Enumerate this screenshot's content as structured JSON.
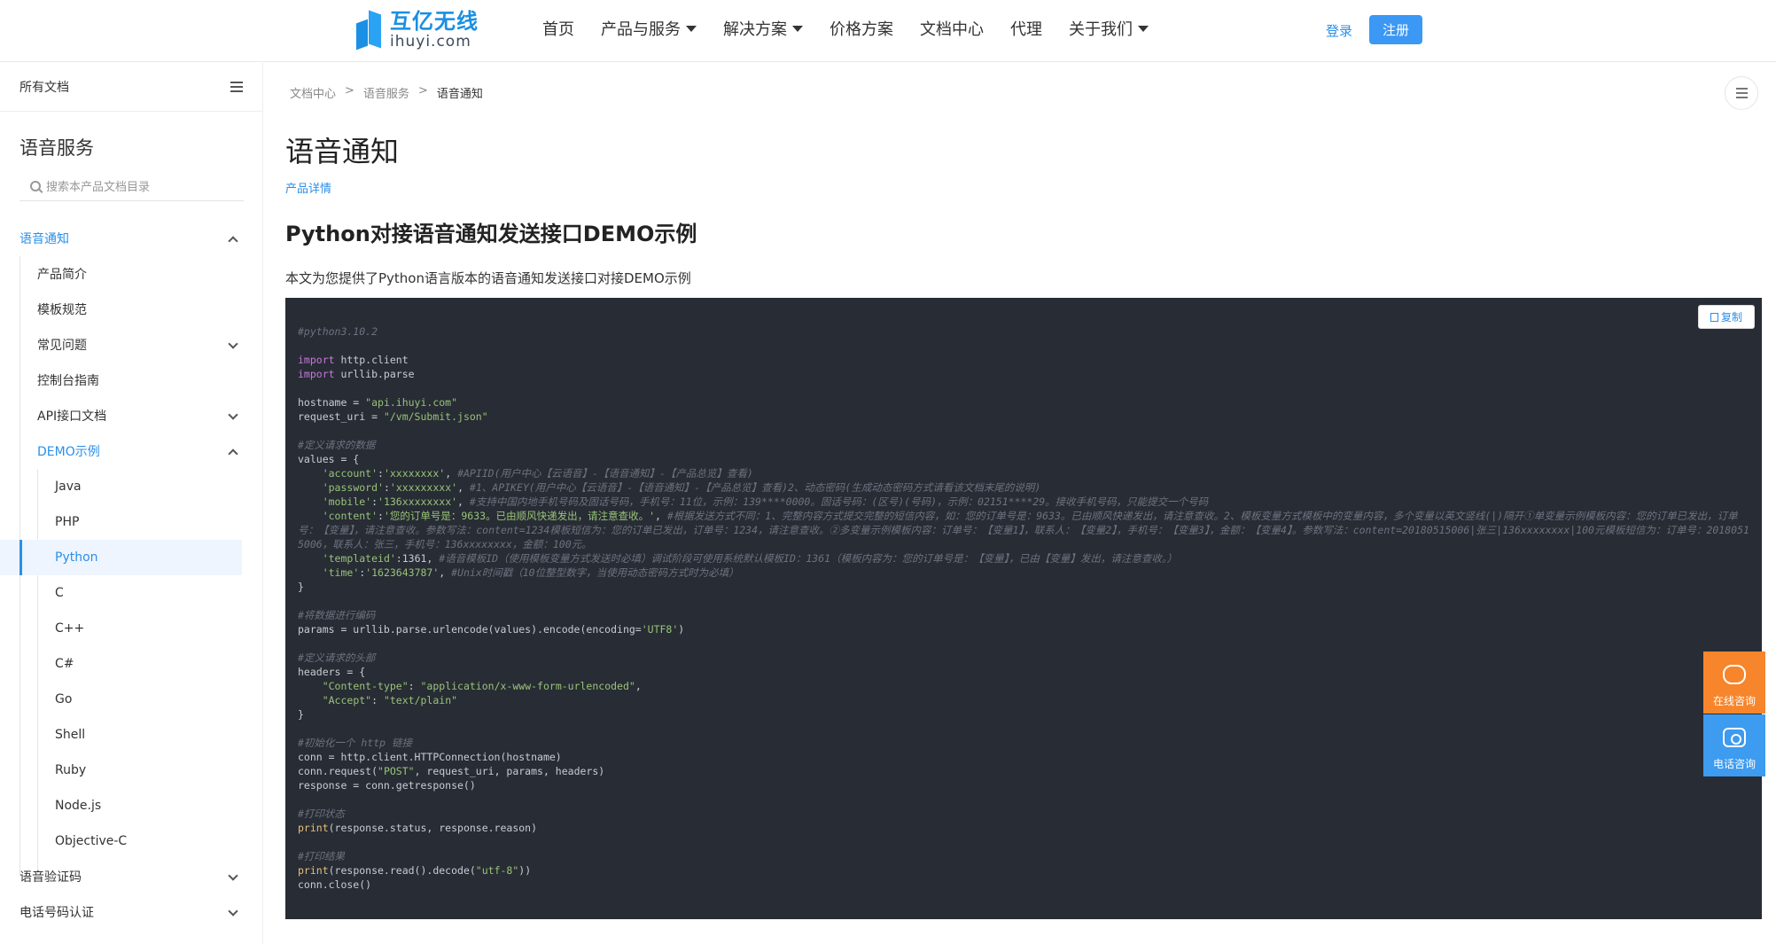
{
  "header": {
    "logo_cn": "互亿无线",
    "logo_en": "ihuyi.com",
    "nav": [
      {
        "label": "首页",
        "dropdown": false
      },
      {
        "label": "产品与服务",
        "dropdown": true
      },
      {
        "label": "解决方案",
        "dropdown": true
      },
      {
        "label": "价格方案",
        "dropdown": false
      },
      {
        "label": "文档中心",
        "dropdown": false
      },
      {
        "label": "代理",
        "dropdown": false
      },
      {
        "label": "关于我们",
        "dropdown": true
      }
    ],
    "login": "登录",
    "register": "注册"
  },
  "sidebar": {
    "all_docs": "所有文档",
    "product_title": "语音服务",
    "search_placeholder": "搜索本产品文档目录",
    "items": [
      {
        "label": "语音通知",
        "level": 1,
        "state": "expanded",
        "highlight": true
      },
      {
        "label": "产品简介",
        "level": 2
      },
      {
        "label": "模板规范",
        "level": 2
      },
      {
        "label": "常见问题",
        "level": 2,
        "state": "collapsed"
      },
      {
        "label": "控制台指南",
        "level": 2
      },
      {
        "label": "API接口文档",
        "level": 2,
        "state": "collapsed"
      },
      {
        "label": "DEMO示例",
        "level": 2,
        "state": "expanded",
        "highlight": true
      },
      {
        "label": "Java",
        "level": 3
      },
      {
        "label": "PHP",
        "level": 3
      },
      {
        "label": "Python",
        "level": 3,
        "active": true
      },
      {
        "label": "C",
        "level": 3
      },
      {
        "label": "C++",
        "level": 3
      },
      {
        "label": "C#",
        "level": 3
      },
      {
        "label": "Go",
        "level": 3
      },
      {
        "label": "Shell",
        "level": 3
      },
      {
        "label": "Ruby",
        "level": 3
      },
      {
        "label": "Node.js",
        "level": 3
      },
      {
        "label": "Objective-C",
        "level": 3
      },
      {
        "label": "语音验证码",
        "level": 1,
        "state": "collapsed"
      },
      {
        "label": "电话号码认证",
        "level": 1,
        "state": "collapsed"
      }
    ]
  },
  "breadcrumb": [
    "文档中心",
    ">",
    "语音服务",
    ">",
    "语音通知"
  ],
  "main": {
    "title": "语音通知",
    "product_detail": "产品详情",
    "section_title": "Python对接语音通知发送接口DEMO示例",
    "intro": "本文为您提供了Python语言版本的语音通知发送接口对接DEMO示例",
    "copy_label": "复制"
  },
  "code_lines": [
    [
      [
        "c",
        "#python3.10.2"
      ]
    ],
    [],
    [
      [
        "k",
        "import"
      ],
      [
        "t",
        " http.client"
      ]
    ],
    [
      [
        "k",
        "import"
      ],
      [
        "t",
        " urllib.parse"
      ]
    ],
    [],
    [
      [
        "t",
        "hostname = "
      ],
      [
        "s",
        "\"api.ihuyi.com\""
      ]
    ],
    [
      [
        "t",
        "request_uri = "
      ],
      [
        "s",
        "\"/vm/Submit.json\""
      ]
    ],
    [],
    [
      [
        "c",
        "#定义请求的数据"
      ]
    ],
    [
      [
        "t",
        "values = {"
      ]
    ],
    [
      [
        "t",
        "    "
      ],
      [
        "s",
        "'account'"
      ],
      [
        "t",
        ":"
      ],
      [
        "s",
        "'xxxxxxxx'"
      ],
      [
        "t",
        ", "
      ],
      [
        "c",
        "#APIID(用户中心【云语音】-【语音通知】-【产品总览】查看)"
      ]
    ],
    [
      [
        "t",
        "    "
      ],
      [
        "s",
        "'password'"
      ],
      [
        "t",
        ":"
      ],
      [
        "s",
        "'xxxxxxxxx'"
      ],
      [
        "t",
        ", "
      ],
      [
        "c",
        "#1、APIKEY(用户中心【云语音】-【语音通知】-【产品总览】查看)2、动态密码(生成动态密码方式请看该文档末尾的说明)"
      ]
    ],
    [
      [
        "t",
        "    "
      ],
      [
        "s",
        "'mobile'"
      ],
      [
        "t",
        ":"
      ],
      [
        "s",
        "'136xxxxxxxx'"
      ],
      [
        "t",
        ", "
      ],
      [
        "c",
        "#支持中国内地手机号码及固话号码，手机号：11位，示例：139****0000。固话号码：(区号)(号码)，示例：02151****29。接收手机号码，只能提交一个号码"
      ]
    ],
    [
      [
        "t",
        "    "
      ],
      [
        "s",
        "'content'"
      ],
      [
        "t",
        ":"
      ],
      [
        "s",
        "'您的订单号是：9633。已由顺风快递发出，请注意查收。'"
      ],
      [
        "t",
        ", "
      ],
      [
        "c",
        "#根据发送方式不同：1、完整内容方式提交完整的短信内容，如：您的订单号是：9633。已由顺风快递发出，请注意查收。2、模板变量方式模板中的变量内容，多个变量以英文竖线(|)隔开①单变量示例模板内容：您的订单已发出，订单号：【变量】，请注意查收。参数写法：content=1234模板短信为：您的订单已发出，订单号：1234，请注意查收。②多变量示例模板内容：订单号：【变量1】，联系人：【变量2】，手机号：【变量3】，金额：【变量4】。参数写法：content=20180515006|张三|136xxxxxxxx|100元模板短信为：订单号：20180515006，联系人：张三，手机号：136xxxxxxxx，金额：100元。"
      ]
    ],
    [
      [
        "t",
        "    "
      ],
      [
        "s",
        "'templateid'"
      ],
      [
        "t",
        ":1361, "
      ],
      [
        "c",
        "#语音模板ID（使用模板变量方式发送时必填）调试阶段可使用系统默认模板ID：1361（模板内容为：您的订单号是：【变量】，已由【变量】发出，请注意查收。）"
      ]
    ],
    [
      [
        "t",
        "    "
      ],
      [
        "s",
        "'time'"
      ],
      [
        "t",
        ":"
      ],
      [
        "s",
        "'1623643787'"
      ],
      [
        "t",
        ", "
      ],
      [
        "c",
        "#Unix时间戳（10位整型数字，当使用动态密码方式时为必填）"
      ]
    ],
    [
      [
        "t",
        "}"
      ]
    ],
    [],
    [
      [
        "c",
        "#将数据进行编码"
      ]
    ],
    [
      [
        "t",
        "params = urllib.parse.urlencode(values).encode(encoding="
      ],
      [
        "s",
        "'UTF8'"
      ],
      [
        "t",
        ")"
      ]
    ],
    [],
    [
      [
        "c",
        "#定义请求的头部"
      ]
    ],
    [
      [
        "t",
        "headers = {"
      ]
    ],
    [
      [
        "t",
        "    "
      ],
      [
        "s",
        "\"Content-type\""
      ],
      [
        "t",
        ": "
      ],
      [
        "s",
        "\"application/x-www-form-urlencoded\""
      ],
      [
        "t",
        ","
      ]
    ],
    [
      [
        "t",
        "    "
      ],
      [
        "s",
        "\"Accept\""
      ],
      [
        "t",
        ": "
      ],
      [
        "s",
        "\"text/plain\""
      ]
    ],
    [
      [
        "t",
        "}"
      ]
    ],
    [],
    [
      [
        "c",
        "#初始化一个 http 链接"
      ]
    ],
    [
      [
        "t",
        "conn = http.client.HTTPConnection(hostname)"
      ]
    ],
    [
      [
        "t",
        "conn.request("
      ],
      [
        "s",
        "\"POST\""
      ],
      [
        "t",
        ", request_uri, params, headers)"
      ]
    ],
    [
      [
        "t",
        "response = conn.getresponse()"
      ]
    ],
    [],
    [
      [
        "c",
        "#打印状态"
      ]
    ],
    [
      [
        "f",
        "print"
      ],
      [
        "t",
        "(response.status, response.reason)"
      ]
    ],
    [],
    [
      [
        "c",
        "#打印结果"
      ]
    ],
    [
      [
        "f",
        "print"
      ],
      [
        "t",
        "(response.read().decode("
      ],
      [
        "s",
        "\"utf-8\""
      ],
      [
        "t",
        "))"
      ]
    ],
    [
      [
        "t",
        "conn.close()"
      ]
    ]
  ],
  "float": {
    "online": "在线咨询",
    "phone": "电话咨询"
  },
  "colors": {
    "brand": "#2a8fea",
    "code_bg": "#282c34",
    "online_bg": "#f7852b",
    "phone_bg": "#3d9bf0"
  }
}
